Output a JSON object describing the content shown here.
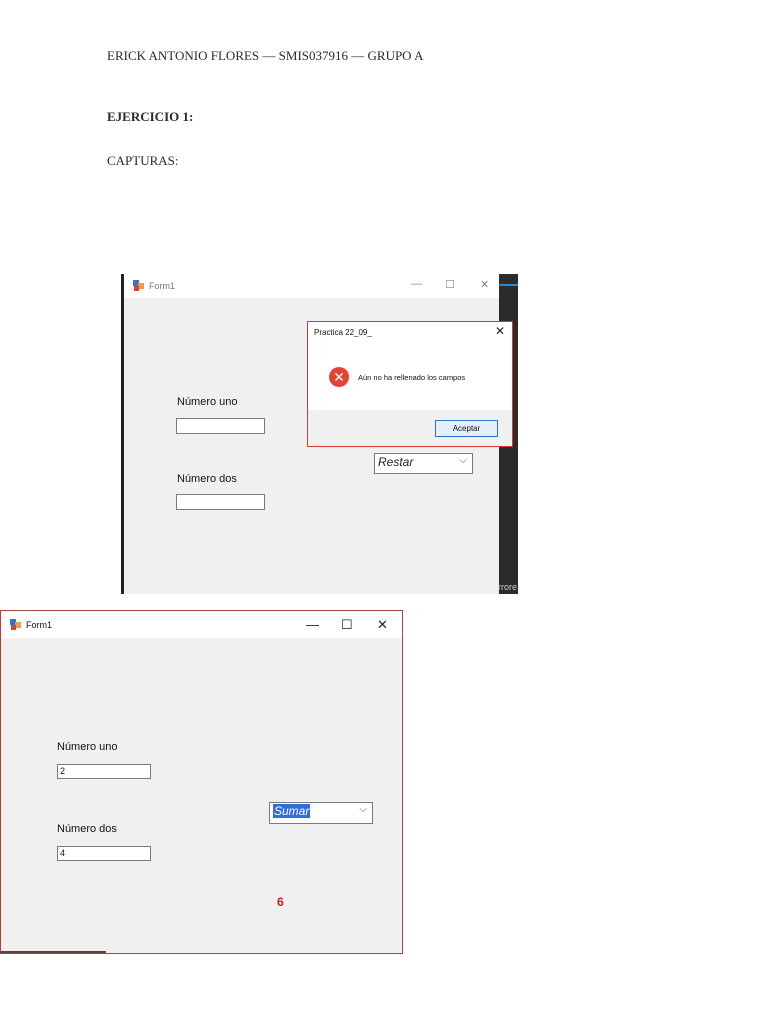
{
  "header": {
    "student_line": "ERICK ANTONIO FLORES — SMIS037916 — GRUPO A",
    "exercise_heading": "EJERCICIO 1:",
    "captures_label": "CAPTURAS:"
  },
  "screenshot_1": {
    "window_title": "Form1",
    "minimize_glyph": "—",
    "maximize_glyph": "☐",
    "close_glyph": "✕",
    "label_numero_uno": "Número uno",
    "label_numero_dos": "Número dos",
    "input_uno_value": "",
    "input_dos_value": "",
    "operation_selected": "Restar",
    "side_panel_text": "rrore",
    "message_box": {
      "title": "Practica 22_09_",
      "message": "Aún no ha rellenado los campos",
      "ok_label": "Aceptar",
      "close_glyph": "✕",
      "error_glyph": "✕"
    }
  },
  "screenshot_2": {
    "window_title": "Form1",
    "minimize_glyph": "—",
    "maximize_glyph": "☐",
    "close_glyph": "✕",
    "label_numero_uno": "Número uno",
    "label_numero_dos": "Número dos",
    "input_uno_value": "2",
    "input_dos_value": "4",
    "operation_selected": "Sumar",
    "result_value": "6"
  },
  "colors": {
    "result_red": "#d01818",
    "error_icon_red": "#e34234",
    "selection_blue": "#2f6fd8"
  }
}
